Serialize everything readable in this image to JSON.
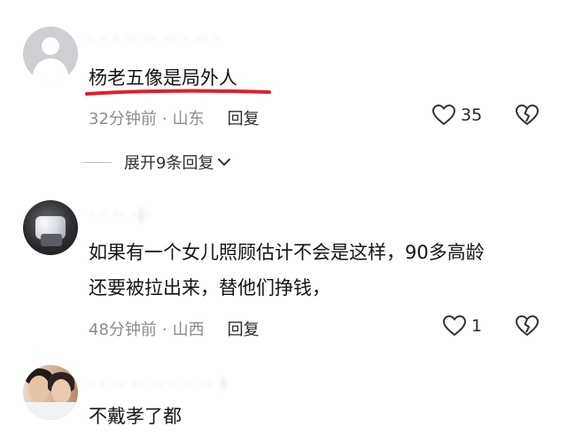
{
  "comments": [
    {
      "username": "· · · ·· ·· ·· · ·· ·",
      "text": "杨老五像是局外人",
      "time": "32分钟前",
      "location": "山东",
      "reply_label": "回复",
      "likes": "35",
      "expand_label": "展开9条回复"
    },
    {
      "username": "· · ·· ·|·",
      "text_line1": "如果有一个女儿照顾估计不会是这样，90多高龄",
      "text_line2": "还要被拉出来，替他们挣钱，",
      "time": "48分钟前",
      "location": "山西",
      "reply_label": "回复",
      "likes": "1"
    },
    {
      "username": "· · ·· ·· ·· · ·· ·· !",
      "text": "不戴孝了都"
    }
  ],
  "separator_dot": "·",
  "colors": {
    "underline": "#e0202a",
    "meta": "#8c8c8c",
    "text": "#141414"
  },
  "icons": {
    "like": "heart-outline-icon",
    "dislike": "broken-heart-icon",
    "expand": "chevron-down-icon",
    "avatar_default": "default-user-icon"
  }
}
